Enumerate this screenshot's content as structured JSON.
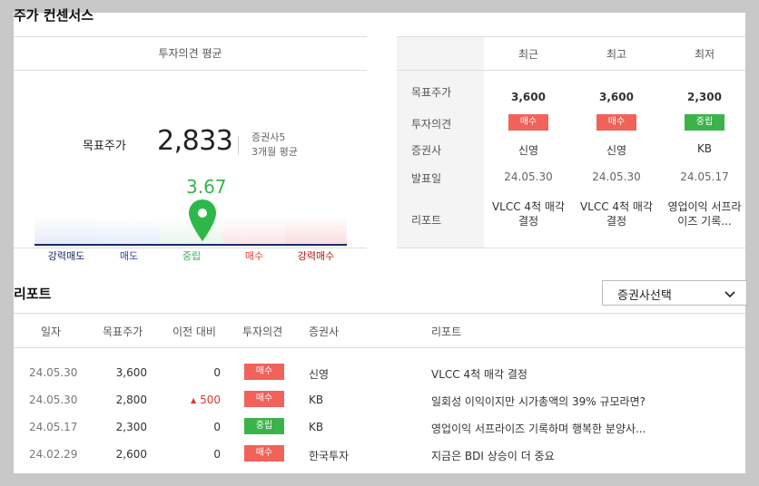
{
  "section_title": "주가 컨센서스",
  "consensus": {
    "header": "투자의견 평균",
    "target_label": "목표주가",
    "target_value": "2,833",
    "analyst_count": "증권사5",
    "period": "3개월 평균",
    "score": "3.67",
    "scale_labels": [
      "강력매도",
      "매도",
      "중립",
      "매수",
      "강력매수"
    ],
    "scale_colors": [
      "#1a2a6a",
      "#1a2a6a",
      "#36b34f",
      "#e0392f",
      "#b01818"
    ],
    "pin_color": "#2eb84a",
    "score_fraction": 0.667
  },
  "recent_table": {
    "columns": [
      "최근",
      "최고",
      "최저"
    ],
    "row_labels": [
      "목표주가",
      "투자의견",
      "증권사",
      "발표일",
      "리포트"
    ],
    "cells": [
      {
        "price": "3,600",
        "opinion": "매수",
        "opinion_type": "buy",
        "broker": "신영",
        "date": "24.05.30",
        "report": "VLCC 4척 매각 결정"
      },
      {
        "price": "3,600",
        "opinion": "매수",
        "opinion_type": "buy",
        "broker": "신영",
        "date": "24.05.30",
        "report": "VLCC 4척 매각 결정"
      },
      {
        "price": "2,300",
        "opinion": "중립",
        "opinion_type": "neutral",
        "broker": "KB",
        "date": "24.05.17",
        "report": "영업이익 서프라이즈 기록..."
      }
    ]
  },
  "reports": {
    "title": "리포트",
    "broker_select": "증권사선택",
    "headers": [
      "일자",
      "목표주가",
      "이전 대비",
      "투자의견",
      "증권사",
      "리포트"
    ],
    "rows": [
      {
        "date": "24.05.30",
        "price": "3,600",
        "change": "0",
        "change_dir": "",
        "opinion": "매수",
        "opinion_type": "buy",
        "broker": "신영",
        "title": "VLCC 4척 매각 결정"
      },
      {
        "date": "24.05.30",
        "price": "2,800",
        "change": "500",
        "change_dir": "up",
        "opinion": "매수",
        "opinion_type": "buy",
        "broker": "KB",
        "title": "일회성 이익이지만 시가총액의 39% 규모라면?"
      },
      {
        "date": "24.05.17",
        "price": "2,300",
        "change": "0",
        "change_dir": "",
        "opinion": "중립",
        "opinion_type": "neutral",
        "broker": "KB",
        "title": "영업이익 서프라이즈 기록하며 행복한 분양사..."
      },
      {
        "date": "24.02.29",
        "price": "2,600",
        "change": "0",
        "change_dir": "",
        "opinion": "매수",
        "opinion_type": "buy",
        "broker": "한국투자",
        "title": "지금은 BDI 상승이 더 중요"
      }
    ]
  }
}
